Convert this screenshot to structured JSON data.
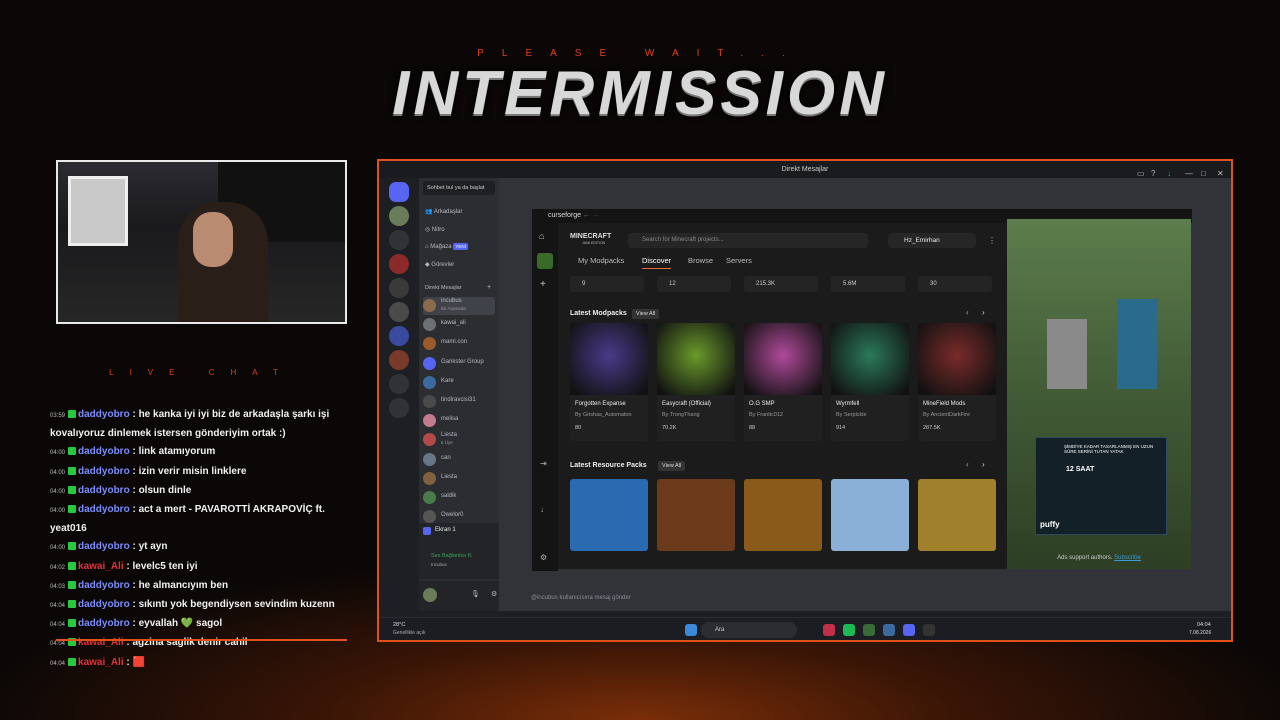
{
  "header": {
    "please_wait": "PLEASE WAIT...",
    "title": "INTERMISSION"
  },
  "live_chat_label": "LIVE CHAT",
  "chat": [
    {
      "time": "03:59",
      "user": "daddyobro",
      "color": "#7a8cff",
      "badge": "#27c93f",
      "text": "he kanka iyi iyi biz de arkadaşla şarkı işi kovalıyoruz dinlemek istersen gönderiyim ortak :)"
    },
    {
      "time": "04:00",
      "user": "daddyobro",
      "color": "#7a8cff",
      "badge": "#27c93f",
      "text": "link atamıyorum"
    },
    {
      "time": "04:00",
      "user": "daddyobro",
      "color": "#7a8cff",
      "badge": "#27c93f",
      "text": "izin verir misin linklere"
    },
    {
      "time": "04:00",
      "user": "daddyobro",
      "color": "#7a8cff",
      "badge": "#27c93f",
      "text": "olsun dinle"
    },
    {
      "time": "04:00",
      "user": "daddyobro",
      "color": "#7a8cff",
      "badge": "#27c93f",
      "text": "act a mert - PAVAROTTİ AKRAPOVİÇ ft. yeat016"
    },
    {
      "time": "04:00",
      "user": "daddyobro",
      "color": "#7a8cff",
      "badge": "#27c93f",
      "text": "yt ayn"
    },
    {
      "time": "04:02",
      "user": "kawai_Ali",
      "color": "#e0323c",
      "badge": "#27c93f",
      "text": "levelc5 ten iyi"
    },
    {
      "time": "04:03",
      "user": "daddyobro",
      "color": "#7a8cff",
      "badge": "#27c93f",
      "text": "he almancıyım ben"
    },
    {
      "time": "04:04",
      "user": "daddyobro",
      "color": "#7a8cff",
      "badge": "#27c93f",
      "text": "sıkıntı yok begendiysen sevindim kuzenn"
    },
    {
      "time": "04:04",
      "user": "daddyobro",
      "color": "#7a8cff",
      "badge": "#27c93f",
      "text": "eyvallah 💚 sagol"
    },
    {
      "time": "04:04",
      "user": "kawai_Ali",
      "color": "#e0323c",
      "badge": "#27c93f",
      "text": "agzina saglik denir cahil"
    },
    {
      "time": "04:04",
      "user": "kawai_Ali",
      "color": "#e0323c",
      "badge": "#27c93f",
      "text": "🟥"
    }
  ],
  "discord": {
    "window_title": "Direkt Mesajlar",
    "search_placeholder": "Sohbet bul ya da başlat",
    "nav": [
      "Arkadaşlar",
      "Nitro",
      "Mağaza",
      "Görevler"
    ],
    "nav_badge": "YENİ",
    "dm_header": "Direkt Mesajlar",
    "dms": [
      {
        "name": "incubus",
        "sub": "Bir Aramada",
        "color": "#8a6b4e"
      },
      {
        "name": "kawai_ali",
        "sub": "",
        "color": "#6b6f76"
      },
      {
        "name": "mami.con",
        "sub": "",
        "color": "#9a5a2a"
      },
      {
        "name": "Gankster Group",
        "sub": "",
        "color": "#5865f2"
      },
      {
        "name": "Kare",
        "sub": "",
        "color": "#3a6aa0"
      },
      {
        "name": "tindiravcisi31",
        "sub": "",
        "color": "#4a4a4a"
      },
      {
        "name": "melisa",
        "sub": "",
        "color": "#c27c8e"
      },
      {
        "name": "Liesta",
        "sub": "6 Üye",
        "color": "#b34a4a"
      },
      {
        "name": "can",
        "sub": "",
        "color": "#667788"
      },
      {
        "name": "Liesta",
        "sub": "",
        "color": "#806040"
      },
      {
        "name": "saldik",
        "sub": "",
        "color": "#4a7a4a"
      },
      {
        "name": "Owelor0",
        "sub": "",
        "color": "#555"
      }
    ],
    "screen_share": "Ekran 1",
    "voice_status": "Ses Bağlantısı K",
    "voice_channel": "Incubus",
    "message_placeholder": "@incubus kullanıcısına mesaj gönder"
  },
  "curseforge": {
    "app_name": "curseforge",
    "logo": "MINECRAFT",
    "logo_sub": "JAVA EDITION",
    "search_placeholder": "Search for Minecraft projects...",
    "user": "Hz_Emirhan",
    "tabs": [
      "My Modpacks",
      "Discover",
      "Browse",
      "Servers"
    ],
    "active_tab": "Discover",
    "stats": [
      "9",
      "12",
      "215.3K",
      "5.6M",
      "30"
    ],
    "latest_modpacks_label": "Latest Modpacks",
    "view_all": "View All",
    "modpacks": [
      {
        "name": "Forgotten Expanse",
        "author": "By Grishas_Automaton",
        "downloads": "80",
        "color": "#4a3a8a"
      },
      {
        "name": "Easycraft (Official)",
        "author": "By TrongThang",
        "downloads": "70.2K",
        "color": "#6a9a2a"
      },
      {
        "name": "O.G SMP",
        "author": "By Frantic012",
        "downloads": "88",
        "color": "#b04a9a"
      },
      {
        "name": "Wyrmfell",
        "author": "By Serpickle",
        "downloads": "914",
        "color": "#2a7a5a"
      },
      {
        "name": "MineField Mods",
        "author": "By AncientDarkFire",
        "downloads": "287.5K",
        "color": "#7a2a2a"
      }
    ],
    "latest_resource_label": "Latest Resource Packs",
    "resource_colors": [
      "#2a6ab0",
      "#6a3a1a",
      "#8a5a1a",
      "#8ab0d8",
      "#a0802a"
    ],
    "ad_support": "Ads support authors.",
    "subscribe": "Subscribe",
    "ad_text": "ŞİMDİYE KADAR TASARLANMIŞ EN UZUN SÜRE SERİNİ TUTAN YATAK",
    "ad_hours": "12 SAAT",
    "ad_brand": "puffy"
  },
  "taskbar": {
    "weather": "28°C",
    "weather_sub": "Genellikle açık",
    "search": "Ara",
    "time": "04:04",
    "date": "7.08.2026"
  }
}
